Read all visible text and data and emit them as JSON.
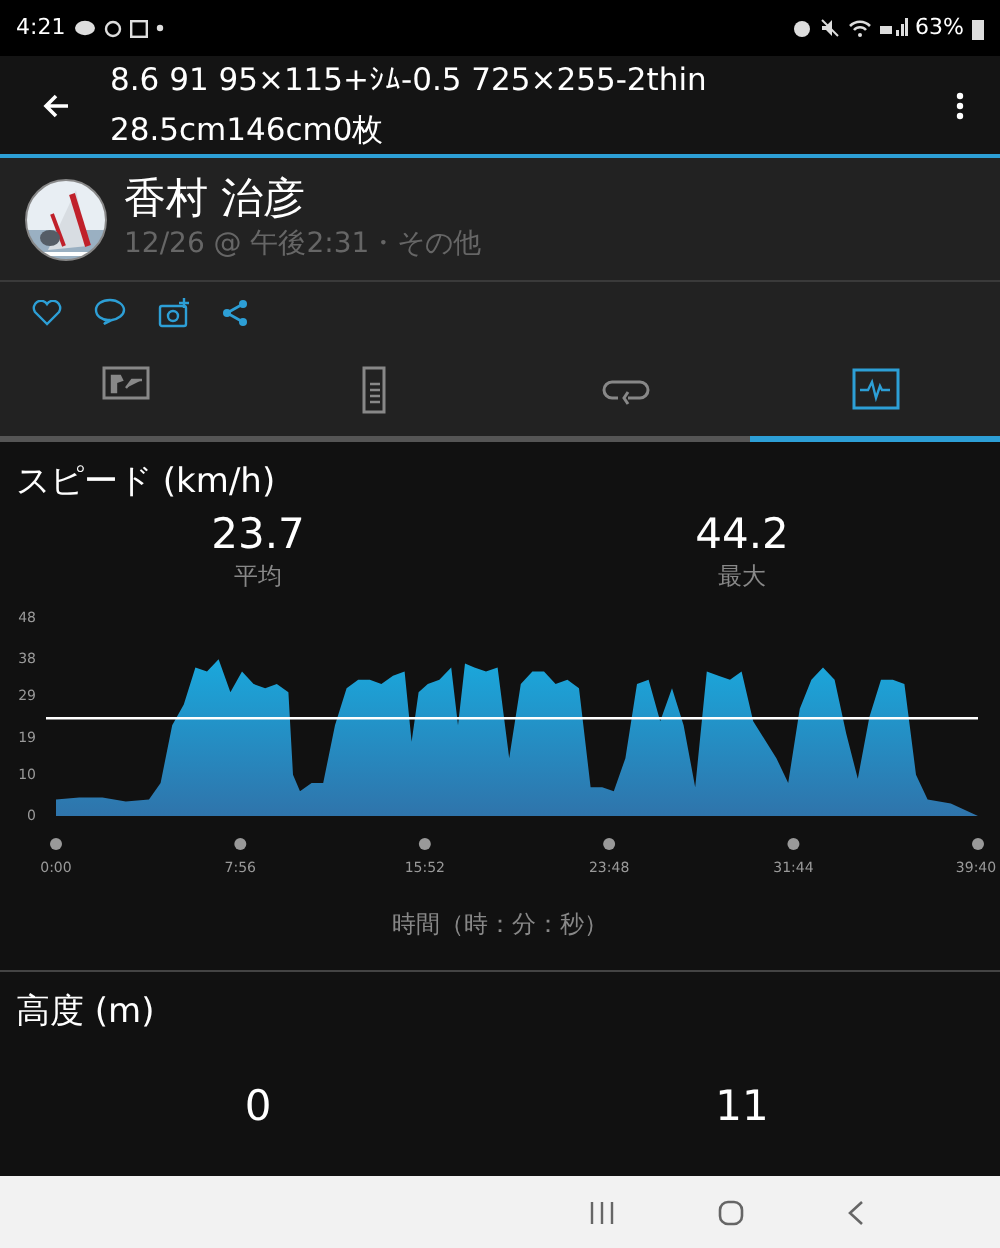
{
  "status_bar": {
    "time": "4:21",
    "battery": "63%"
  },
  "app_bar": {
    "title_lines": [
      "8.6 91 95×115+ｼﾑ-0.5 725×255-2thin",
      "28.5cm146cm0枚"
    ]
  },
  "activity": {
    "name": "香村 治彦",
    "subtitle": "12/26 @ 午後2:31・その他"
  },
  "tabs": [
    {
      "kind": "overview",
      "selected": false
    },
    {
      "kind": "details",
      "selected": false
    },
    {
      "kind": "laps",
      "selected": false
    },
    {
      "kind": "charts",
      "selected": true
    }
  ],
  "speed": {
    "title": "スピード (km/h)",
    "stats": [
      {
        "value": "23.7",
        "label": "平均"
      },
      {
        "value": "44.2",
        "label": "最大"
      }
    ],
    "chart_data": {
      "type": "area",
      "xlabel": "時間（時：分：秒）",
      "x": [
        0,
        1,
        2,
        3,
        4,
        4.5,
        5,
        5.5,
        6,
        6.5,
        7,
        7.5,
        8,
        8.5,
        9,
        9.5,
        10,
        10.2,
        10.5,
        11,
        11.5,
        12,
        12.5,
        13,
        13.5,
        14,
        14.5,
        15,
        15.3,
        15.6,
        16,
        16.5,
        17,
        17.3,
        17.6,
        18,
        18.5,
        19,
        19.5,
        20,
        20.5,
        21,
        21.5,
        22,
        22.5,
        23,
        23.5,
        24,
        24.5,
        25,
        25.5,
        26,
        26.5,
        27,
        27.5,
        28,
        28.5,
        29,
        29.5,
        30,
        31,
        31.5,
        32,
        32.5,
        33,
        33.5,
        34,
        34.5,
        35,
        35.5,
        36,
        36.5,
        37,
        37.5,
        38.5,
        39.67
      ],
      "series": [
        {
          "color": "#1aa8dc",
          "values": [
            4,
            4.5,
            4.5,
            3.5,
            4,
            8,
            22,
            27,
            36,
            35,
            38,
            30,
            35,
            32,
            31,
            32,
            30,
            10,
            6,
            8,
            8,
            22,
            31,
            33,
            33,
            32,
            34,
            35,
            18,
            30,
            32,
            33,
            36,
            22,
            37,
            36,
            35,
            36,
            14,
            32,
            35,
            35,
            32,
            33,
            31,
            7,
            7,
            6,
            14,
            32,
            33,
            23,
            31,
            22,
            7,
            35,
            34,
            33,
            35,
            23,
            14,
            8,
            26,
            33,
            36,
            33,
            20,
            9,
            24,
            33,
            33,
            32,
            10,
            4,
            3,
            0
          ]
        }
      ],
      "xlim": [
        0,
        39.67
      ],
      "ylim": [
        0,
        48
      ],
      "xticks": [
        {
          "value": 0,
          "label": "0:00"
        },
        {
          "value": 7.93,
          "label": "7:56"
        },
        {
          "value": 15.87,
          "label": "15:52"
        },
        {
          "value": 23.8,
          "label": "23:48"
        },
        {
          "value": 31.73,
          "label": "31:44"
        },
        {
          "value": 39.67,
          "label": "39:40"
        }
      ],
      "yticks": [
        0,
        10,
        19,
        29,
        38,
        48
      ],
      "ref_lines": [
        {
          "axis": "y",
          "value": 23.7
        }
      ]
    }
  },
  "altitude": {
    "title": "高度 (m)",
    "stats": [
      {
        "value": "0"
      },
      {
        "value": "11"
      }
    ]
  }
}
